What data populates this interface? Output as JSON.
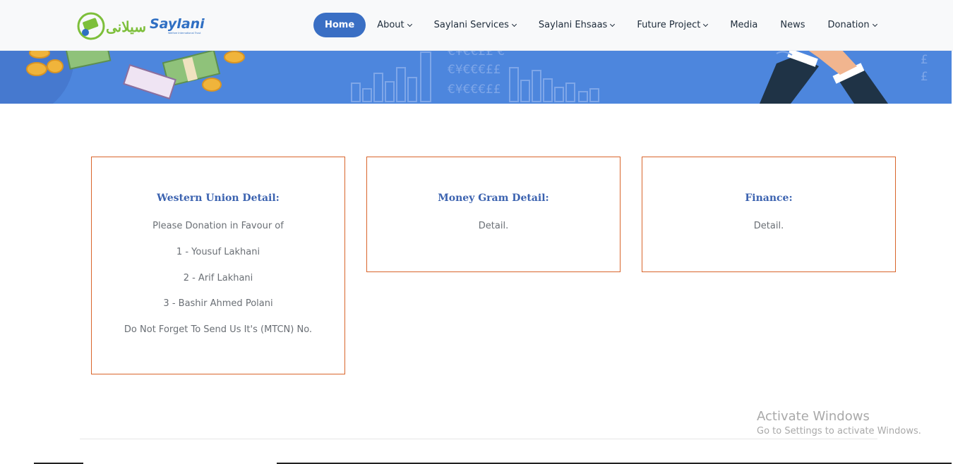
{
  "brand": {
    "logo_text": "Saylani",
    "logo_urdu": "سیلانی",
    "logo_tagline": "Welfare International Trust",
    "colors": {
      "green": "#7dbf3a",
      "blue": "#2f6fc3"
    }
  },
  "nav": {
    "items": [
      {
        "label": "Home",
        "active": true,
        "dropdown": false
      },
      {
        "label": "About",
        "active": false,
        "dropdown": true
      },
      {
        "label": "Saylani Services",
        "active": false,
        "dropdown": true
      },
      {
        "label": "Saylani Ehsaas",
        "active": false,
        "dropdown": true
      },
      {
        "label": "Future Project",
        "active": false,
        "dropdown": true
      },
      {
        "label": "Media",
        "active": false,
        "dropdown": false
      },
      {
        "label": "News",
        "active": false,
        "dropdown": false
      },
      {
        "label": "Donation",
        "active": false,
        "dropdown": true
      }
    ]
  },
  "banner": {
    "currency_rows": [
      "€¥€€££ €",
      "€¥€€€££",
      "€¥€€€££"
    ],
    "pound_signs": [
      "£",
      "£"
    ],
    "color": "#4d86dd"
  },
  "cards": [
    {
      "title": "Western Union Detail:",
      "lines": [
        "Please Donation in Favour of",
        "1 - Yousuf Lakhani",
        "2 - Arif Lakhani",
        "3 - Bashir Ahmed Polani",
        "Do Not Forget To Send Us It's (MTCN) No."
      ]
    },
    {
      "title": "Money Gram Detail:",
      "lines": [
        "Detail."
      ]
    },
    {
      "title": "Finance:",
      "lines": [
        "Detail."
      ]
    }
  ],
  "watermark": {
    "title": "Activate Windows",
    "subtitle": "Go to Settings to activate Windows."
  }
}
